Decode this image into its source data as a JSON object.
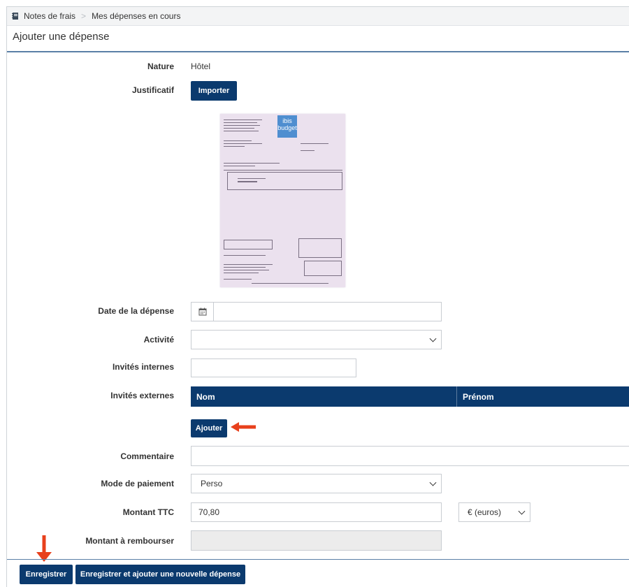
{
  "breadcrumb": {
    "icon": "notebook-icon",
    "root": "Notes de frais",
    "separator": ">",
    "current": "Mes dépenses en cours"
  },
  "page_title": "Ajouter une dépense",
  "form": {
    "nature": {
      "label": "Nature",
      "value": "Hôtel"
    },
    "justificatif": {
      "label": "Justificatif",
      "button": "Importer"
    },
    "date": {
      "label": "Date de la dépense",
      "value": "",
      "icon": "calendar-icon"
    },
    "activite": {
      "label": "Activité",
      "value": ""
    },
    "invites_internes": {
      "label": "Invités internes",
      "value": ""
    },
    "invites_externes": {
      "label": "Invités externes",
      "columns": [
        "Nom",
        "Prénom"
      ],
      "add_button": "Ajouter"
    },
    "commentaire": {
      "label": "Commentaire",
      "value": ""
    },
    "mode_paiement": {
      "label": "Mode de paiement",
      "value": "Perso"
    },
    "montant_ttc": {
      "label": "Montant TTC",
      "value": "70,80",
      "currency": "€ (euros)"
    },
    "montant_rembourser": {
      "label": "Montant à rembourser",
      "value": ""
    }
  },
  "receipt": {
    "brand_line1": "ibis",
    "brand_line2": "budget"
  },
  "footer": {
    "save": "Enregistrer",
    "save_and_new": "Enregistrer et ajouter une nouvelle dépense"
  },
  "colors": {
    "primary": "#0b3a6e",
    "accent_arrow": "#e8401c",
    "rule": "#5a7fa6"
  }
}
